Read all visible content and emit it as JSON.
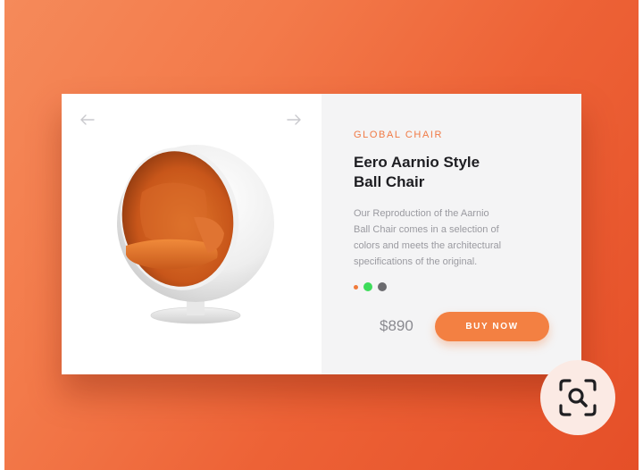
{
  "product": {
    "brand": "GLOBAL CHAIR",
    "title_lines": [
      "Eero Aarnio Style",
      "Ball Chair"
    ],
    "description_lines": [
      "Our Reproduction of the Aarnio",
      "Ball Chair comes in a selection of",
      "colors and meets the architectural",
      "specifications of the original."
    ],
    "price": "$890",
    "buy_label": "BUY NOW",
    "color_options": [
      {
        "name": "orange",
        "color": "#f07a3a",
        "selected": true
      },
      {
        "name": "green",
        "color": "#3ddc5a",
        "selected": false
      },
      {
        "name": "gray",
        "color": "#6b6b6f",
        "selected": false
      }
    ]
  },
  "carousel": {
    "prev_icon": "arrow-left-icon",
    "next_icon": "arrow-right-icon"
  },
  "overlay": {
    "icon": "visual-search-icon"
  },
  "colors": {
    "accent": "#f38042",
    "brand_text": "#f07a45",
    "title_text": "#1e1e22",
    "body_text": "#9a9aa0",
    "price_text": "#8a8a90",
    "panel_right": "#f4f4f5"
  }
}
